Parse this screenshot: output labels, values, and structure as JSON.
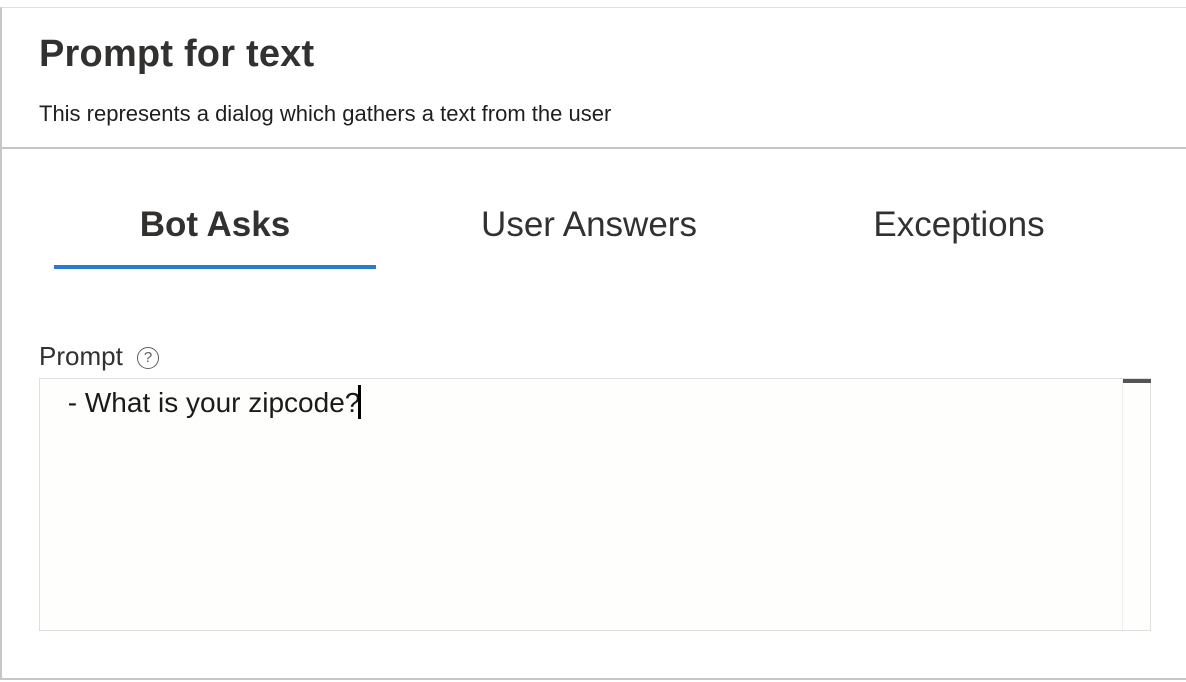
{
  "header": {
    "title": "Prompt for text",
    "description": "This represents a dialog which gathers a text from the user"
  },
  "tabs": [
    {
      "label": "Bot Asks",
      "active": true
    },
    {
      "label": "User Answers",
      "active": false
    },
    {
      "label": "Exceptions",
      "active": false
    }
  ],
  "prompt_field": {
    "label": "Prompt",
    "help_icon": "question-circle-icon",
    "help_glyph": "?",
    "value": " - What is your zipcode?"
  },
  "colors": {
    "accent": "#2b7ad1",
    "text": "#323130",
    "border": "#c8c6c4",
    "editor_background": "#fefefc"
  }
}
